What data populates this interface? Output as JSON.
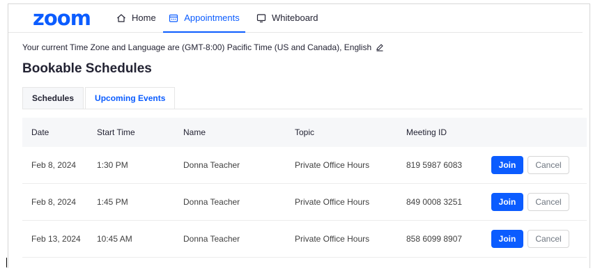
{
  "brand": {
    "logo_text": "zoom",
    "accent_color": "#0b5cff"
  },
  "nav": {
    "tabs": [
      {
        "label": "Home",
        "icon": "home-icon",
        "active": false
      },
      {
        "label": "Appointments",
        "icon": "calendar-icon",
        "active": true
      },
      {
        "label": "Whiteboard",
        "icon": "whiteboard-icon",
        "active": false
      }
    ]
  },
  "timezone_line": "Your current Time Zone and Language are (GMT-8:00) Pacific Time (US and Canada), English",
  "page_title": "Bookable Schedules",
  "subtabs": [
    {
      "label": "Schedules",
      "active": false
    },
    {
      "label": "Upcoming Events",
      "active": true
    }
  ],
  "table": {
    "headers": [
      "Date",
      "Start Time",
      "Name",
      "Topic",
      "Meeting ID"
    ],
    "rows": [
      {
        "date": "Feb 8, 2024",
        "start_time": "1:30 PM",
        "name": "Donna Teacher",
        "topic": "Private Office Hours",
        "meeting_id": "819 5987 6083"
      },
      {
        "date": "Feb 8, 2024",
        "start_time": "1:45 PM",
        "name": "Donna Teacher",
        "topic": "Private Office Hours",
        "meeting_id": "849 0008 3251"
      },
      {
        "date": "Feb 13, 2024",
        "start_time": "10:45 AM",
        "name": "Donna Teacher",
        "topic": "Private Office Hours",
        "meeting_id": "858 6099 8907"
      }
    ],
    "join_label": "Join",
    "cancel_label": "Cancel"
  }
}
